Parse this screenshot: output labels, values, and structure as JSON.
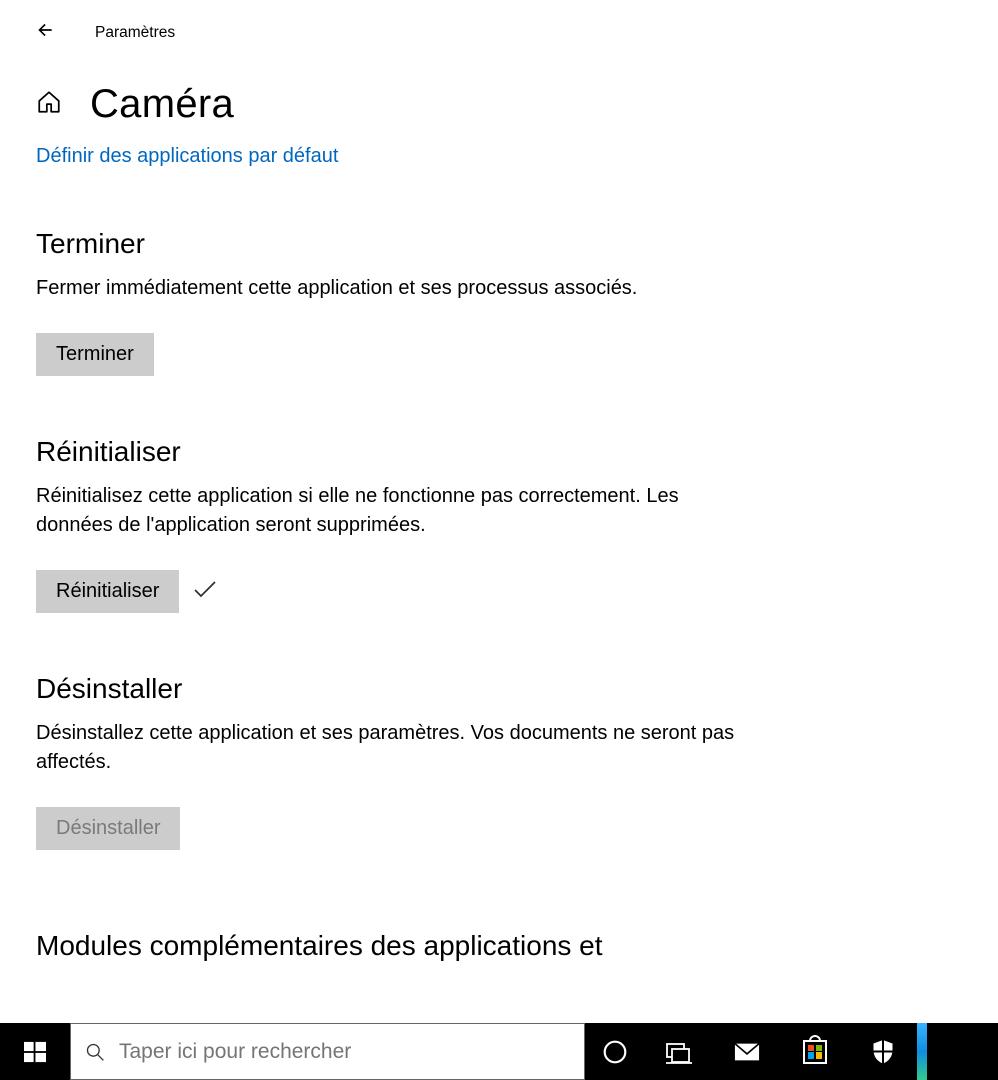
{
  "header": {
    "title": "Paramètres"
  },
  "page": {
    "title": "Caméra",
    "default_apps_link": "Définir des applications par défaut"
  },
  "sections": {
    "terminate": {
      "heading": "Terminer",
      "description": "Fermer immédiatement cette application et ses processus associés.",
      "button": "Terminer"
    },
    "reset": {
      "heading": "Réinitialiser",
      "description": "Réinitialisez cette application si elle ne fonctionne pas correctement. Les données de l'application seront supprimées.",
      "button": "Réinitialiser"
    },
    "uninstall": {
      "heading": "Désinstaller",
      "description": "Désinstallez cette application et ses paramètres. Vos documents ne seront pas affectés.",
      "button": "Désinstaller"
    },
    "addons": {
      "heading": "Modules complémentaires des applications et"
    }
  },
  "taskbar": {
    "search_placeholder": "Taper ici pour rechercher"
  }
}
